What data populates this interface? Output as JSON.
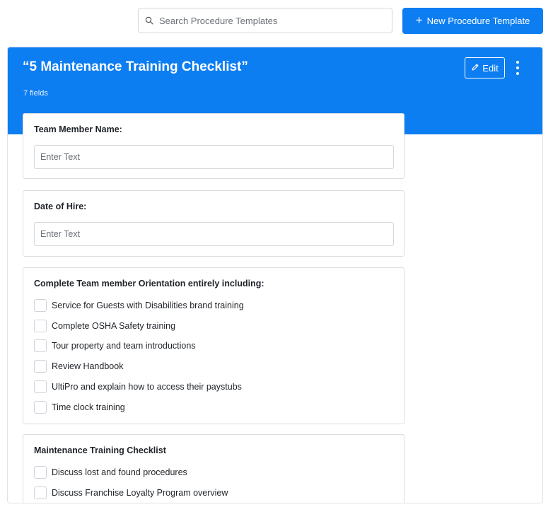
{
  "search": {
    "placeholder": "Search Procedure Templates"
  },
  "toolbar": {
    "new_label": "New Procedure Template"
  },
  "template": {
    "title": "“5 Maintenance Training Checklist”",
    "field_count": "7 fields",
    "edit_label": "Edit"
  },
  "fields": [
    {
      "label": "Team Member Name:",
      "placeholder": "Enter Text"
    },
    {
      "label": "Date of Hire:",
      "placeholder": "Enter Text"
    },
    {
      "label": "Complete Team member Orientation entirely including:",
      "items": [
        "Service for Guests with Disabilities brand training",
        "Complete OSHA Safety training",
        "Tour property and team introductions",
        "Review Handbook",
        "UltiPro and explain how to access their paystubs",
        "Time clock training"
      ]
    },
    {
      "label": "Maintenance Training Checklist",
      "items": [
        "Discuss lost and found procedures",
        "Discuss Franchise Loyalty Program overview"
      ]
    }
  ],
  "colors": {
    "accent": "#0d7ef2"
  },
  "icons": {
    "search": "search-icon",
    "edit": "pencil-icon",
    "more": "more-vertical-icon",
    "add": "plus-icon"
  }
}
